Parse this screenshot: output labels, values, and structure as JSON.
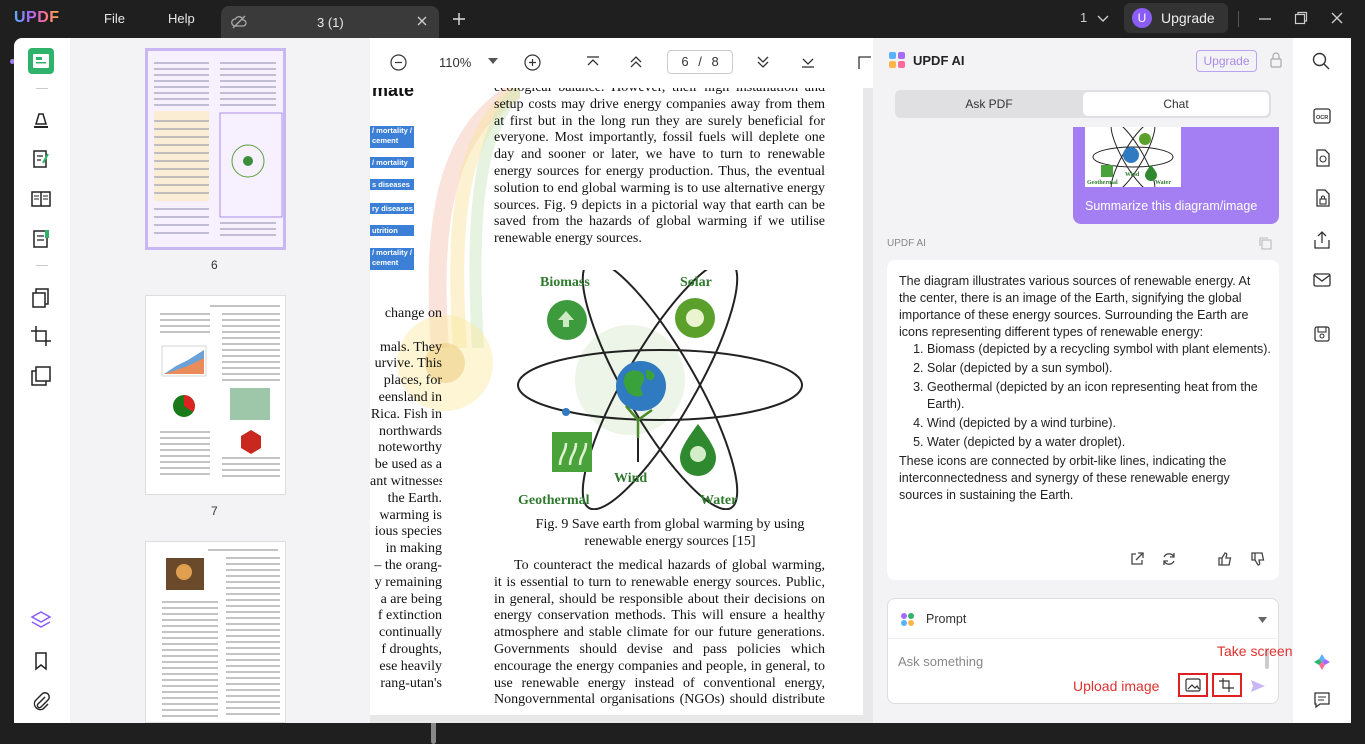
{
  "app": {
    "logo": "UPDF",
    "menu_file": "File",
    "menu_help": "Help"
  },
  "tab": {
    "title": "3 (1)"
  },
  "titlebar": {
    "page_count": "1",
    "upgrade_label": "Upgrade",
    "avatar_letter": "U"
  },
  "toolbar": {
    "zoom": "110%",
    "current_page": "6",
    "page_sep": "/",
    "total_pages": "8"
  },
  "thumbnails": {
    "items": [
      {
        "number": "6"
      },
      {
        "number": "7"
      }
    ]
  },
  "document": {
    "top_text": "ecological balance. However, their high installation and setup costs may drive energy companies away from them at first but in the long run they are surely beneficial for everyone. Most importantly, fossil fuels will deplete one day and sooner or later, we have to turn to renewable energy sources for energy production. Thus, the eventual solution to end global warming is to use alternative energy sources. Fig. 9 depicts in a pictorial way that earth can be saved from the hazards of global warming if we utilise renewable energy sources.",
    "left_heading": "mate",
    "left_bars": [
      "/ mortality / cement",
      "/ mortality",
      "s diseases",
      "ry diseases",
      "utrition",
      "/ mortality / cement"
    ],
    "left_lines": [
      "change on",
      "",
      "mals. They",
      "urvive. This",
      "places, for",
      "eensland in",
      "Rica. Fish in",
      "northwards",
      "noteworthy",
      "be used as a",
      "ant witnesses",
      "the Earth.",
      "warming is",
      "ious species",
      "in making",
      "– the orang-",
      "y remaining",
      "a are being",
      "f extinction",
      "continually",
      "f droughts,",
      "ese heavily",
      "rang-utan's"
    ],
    "figure": {
      "biomass": "Biomass",
      "solar": "Solar",
      "wind": "Wind",
      "geothermal": "Geothermal",
      "water": "Water"
    },
    "caption": "Fig. 9 Save earth from global warming by using renewable energy sources [15]",
    "bottom_text": "To counteract the medical hazards of global warming, it is essential to turn to renewable energy sources. Public, in general, should be responsible about their decisions on energy conservation methods. This will ensure a healthy atmosphere and stable climate for our future generations. Governments should devise and pass policies which encourage the energy companies and people, in general, to use renewable energy instead of conventional energy, Nongovernmental organisations (NGOs) should distribute ..."
  },
  "ai": {
    "title": "UPDF AI",
    "upgrade": "Upgrade",
    "tab_ask": "Ask PDF",
    "tab_chat": "Chat",
    "user_message": "Summarize this diagram/image",
    "sender_label": "UPDF AI",
    "answer_intro": "The diagram illustrates various sources of renewable energy. At the center, there is an image of the Earth, signifying the global importance of these energy sources. Surrounding the Earth are icons representing different types of renewable energy:",
    "answer_items": [
      "Biomass (depicted by a recycling symbol with plant elements).",
      "Solar (depicted by a sun symbol).",
      "Geothermal (depicted by an icon representing heat from the Earth).",
      "Wind (depicted by a wind turbine).",
      "Water (depicted by a water droplet)."
    ],
    "answer_outro": "These icons are connected by orbit-like lines, indicating the interconnectedness and synergy of these renewable energy sources in sustaining the Earth.",
    "prompt_label": "Prompt",
    "input_placeholder": "Ask something",
    "annotation_upload": "Upload image",
    "annotation_screenshot": "Take screenshot"
  },
  "colors": {
    "accent_purple": "#a47ff3",
    "annotation_red": "#e02020",
    "updf_green": "#2fb36b"
  }
}
